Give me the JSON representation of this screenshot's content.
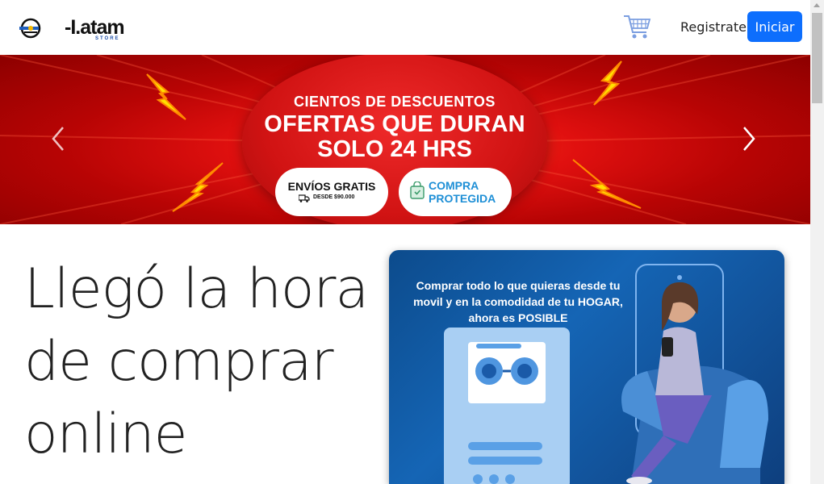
{
  "navbar": {
    "brand_text": "-I.atam",
    "brand_sub": "STORE",
    "register_label": "Registrate",
    "login_label": "Iniciar"
  },
  "carousel": {
    "line1": "CIENTOS DE DESCUENTOS",
    "line2": "OFERTAS QUE DURAN",
    "line3": "SOLO 24 HRS",
    "pill_left_title": "ENVÍOS GRATIS",
    "pill_left_sub": "DESDE $90.000",
    "pill_right_title": "COMPRA PROTEGIDA"
  },
  "hero": {
    "title": "Llegó la hora de comprar online"
  },
  "promo": {
    "text": "Comprar todo lo que quieras desde tu movil y en la comodidad de tu HOGAR, ahora es POSIBLE"
  },
  "colors": {
    "primary": "#0d6efd",
    "banner_red": "#d11313",
    "promo_blue": "#1565b5"
  },
  "icons": [
    "logo-icon",
    "cart-icon",
    "chevron-left-icon",
    "chevron-right-icon",
    "truck-icon",
    "shopping-bag-icon"
  ]
}
